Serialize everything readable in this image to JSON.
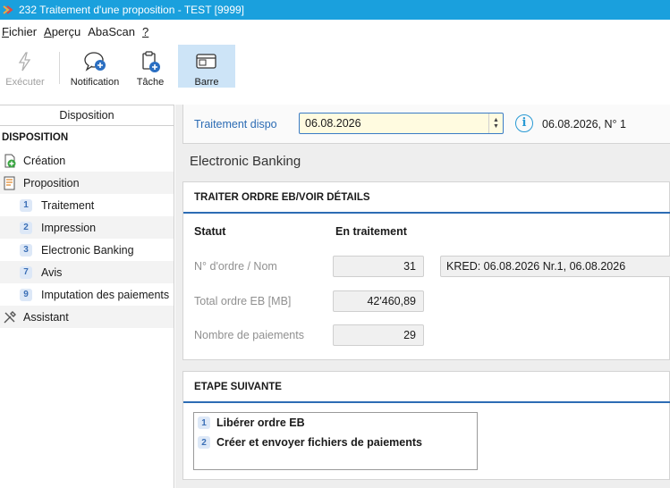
{
  "window": {
    "title": "232 Traitement d'une proposition - TEST [9999]"
  },
  "menu": [
    {
      "label": "Fichier",
      "accel": "F",
      "rest": "ichier"
    },
    {
      "label": "Aperçu",
      "accel": "A",
      "rest": "perçu"
    },
    {
      "label": "AbaScan",
      "accel": "",
      "rest": "AbaScan"
    },
    {
      "label": "?",
      "accel": "?",
      "rest": ""
    }
  ],
  "toolbar": {
    "execute_label": "Exécuter",
    "notification_label": "Notification",
    "task_label": "Tâche",
    "bar_label": "Barre"
  },
  "sidebar": {
    "header": "Disposition",
    "section": "DISPOSITION",
    "items": [
      {
        "label": "Création"
      },
      {
        "label": "Proposition"
      },
      {
        "num": "1",
        "label": "Traitement"
      },
      {
        "num": "2",
        "label": "Impression"
      },
      {
        "num": "3",
        "label": "Electronic Banking"
      },
      {
        "num": "7",
        "label": "Avis"
      },
      {
        "num": "9",
        "label": "Imputation des paiements"
      },
      {
        "label": "Assistant"
      }
    ]
  },
  "topbar": {
    "label": "Traitement dispo",
    "date_value": "06.08.2026",
    "dispo_text": "06.08.2026, N° 1"
  },
  "page_title": "Electronic Banking",
  "details": {
    "title": "TRAITER ORDRE EB/VOIR DÉTAILS",
    "status_label": "Statut",
    "status_value": "En traitement",
    "order_label": "N° d'ordre / Nom",
    "order_number": "31",
    "order_name": "KRED: 06.08.2026 Nr.1, 06.08.2026",
    "total_label": "Total ordre EB [MB]",
    "total_value": "42'460,89",
    "payments_label": "Nombre de paiements",
    "payments_value": "29"
  },
  "next_step": {
    "title": "ETAPE SUIVANTE",
    "steps": [
      {
        "num": "1",
        "label": "Libérer ordre EB"
      },
      {
        "num": "2",
        "label": "Créer et envoyer fichiers de paiements"
      }
    ]
  },
  "colors": {
    "titlebar": "#1aa0dd",
    "accent_blue": "#2c6cb4",
    "active_tool": "#cde4f7",
    "date_field": "#fffbe0"
  }
}
